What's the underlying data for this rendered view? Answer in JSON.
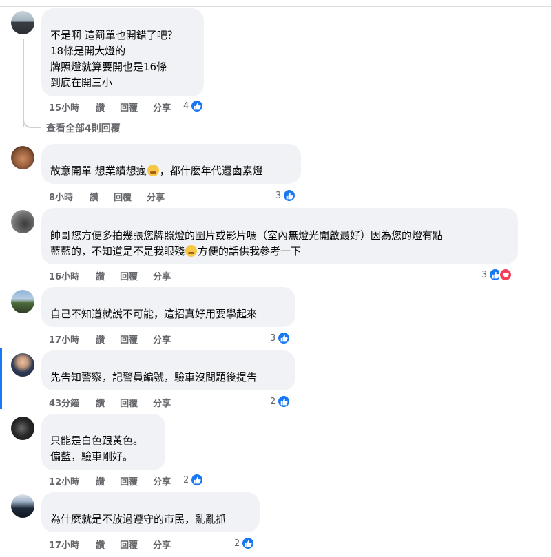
{
  "comments": [
    {
      "lines": [
        "不是啊 這罰單也開錯了吧？",
        "18條是開大燈的",
        "牌照燈就算要開也是16條",
        "到底在開三小"
      ],
      "time": "15小時",
      "like": "讚",
      "reply": "回覆",
      "share": "分享",
      "count": "4",
      "reactions": [
        "like-icon"
      ]
    },
    {
      "line1_a": "故意開單 想業績想瘋",
      "line1_b": "，都什麼年代還鹵素燈",
      "time": "8小時",
      "like": "讚",
      "reply": "回覆",
      "share": "分享",
      "count": "3",
      "reactions": [
        "like-icon"
      ]
    },
    {
      "line1": "帥哥您方便多拍幾張您牌照燈的圖片或影片嗎（室內無燈光開啟最好）因為您的燈有點",
      "line2_a": "藍藍的，不知道是不是我眼殘",
      "line2_b": "方便的話供我參考一下",
      "time": "16小時",
      "like": "讚",
      "reply": "回覆",
      "share": "分享",
      "count": "3",
      "reactions": [
        "like-icon",
        "love-icon"
      ]
    },
    {
      "line1": "自己不知道就說不可能，這招真好用要學起來",
      "time": "17小時",
      "like": "讚",
      "reply": "回覆",
      "share": "分享",
      "count": "3",
      "reactions": [
        "like-icon"
      ]
    },
    {
      "line1": "先告知警察，記警員編號，驗車沒問題後提告",
      "time": "43分鐘",
      "like": "讚",
      "reply": "回覆",
      "share": "分享",
      "count": "2",
      "reactions": [
        "like-icon"
      ]
    },
    {
      "lines": [
        "只能是白色跟黃色。",
        "偏藍，驗車剛好。"
      ],
      "time": "12小時",
      "like": "讚",
      "reply": "回覆",
      "share": "分享",
      "count": "2",
      "reactions": [
        "like-icon"
      ]
    },
    {
      "line1": "為什麼就是不放過遵守的市民，亂亂抓",
      "time": "17小時",
      "like": "讚",
      "reply": "回覆",
      "share": "分享",
      "count": "2",
      "reactions": [
        "like-icon"
      ]
    }
  ],
  "view_all_replies": "查看全部4則回覆",
  "colors": {
    "bubble": "#f0f2f5",
    "meta": "#65676b",
    "like": "#1877f2",
    "love": "#f33e58"
  }
}
